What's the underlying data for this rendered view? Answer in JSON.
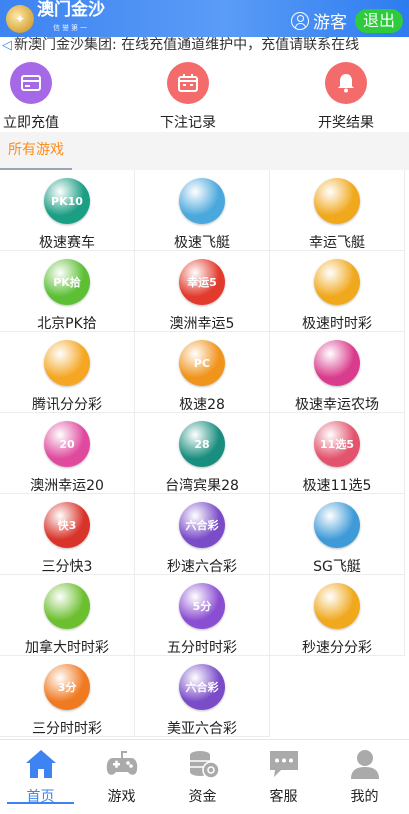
{
  "header": {
    "logo_text": "澳门金沙",
    "logo_sub": "信誉第一",
    "guest_label": "游客",
    "logout_label": "退出",
    "color_bg": "#3d83f2"
  },
  "marquee": {
    "text": "新澳门金沙集团: 在线充值通道维护中，充值请联系在线"
  },
  "quick_actions": [
    {
      "label": "立即充值",
      "icon": "wallet-icon",
      "color": "#a569e8"
    },
    {
      "label": "下注记录",
      "icon": "calendar-icon",
      "color": "#f46b6b"
    },
    {
      "label": "开奖结果",
      "icon": "bell-icon",
      "color": "#f46b6b"
    }
  ],
  "section": {
    "tab_label": "所有游戏",
    "accent": "#ff8c1a"
  },
  "games": [
    {
      "label": "极速赛车",
      "badge": "PK10",
      "color": "#1a9e84"
    },
    {
      "label": "极速飞艇",
      "badge": "",
      "color": "#4aa8dc"
    },
    {
      "label": "幸运飞艇",
      "badge": "",
      "color": "#f0a81c"
    },
    {
      "label": "北京PK拾",
      "badge": "PK拾",
      "color": "#5cbf34"
    },
    {
      "label": "澳洲幸运5",
      "badge": "幸运5",
      "color": "#e23a2c"
    },
    {
      "label": "极速时时彩",
      "badge": "",
      "color": "#f0a81c"
    },
    {
      "label": "腾讯分分彩",
      "badge": "",
      "color": "#f5a623"
    },
    {
      "label": "极速28",
      "badge": "PC",
      "color": "#f0941c"
    },
    {
      "label": "极速幸运农场",
      "badge": "",
      "color": "#d93c8c"
    },
    {
      "label": "澳洲幸运20",
      "badge": "20",
      "color": "#e04a9e"
    },
    {
      "label": "台湾宾果28",
      "badge": "28",
      "color": "#1a8e7e"
    },
    {
      "label": "极速11选5",
      "badge": "11选5",
      "color": "#e2546e"
    },
    {
      "label": "三分快3",
      "badge": "快3",
      "color": "#d8342a"
    },
    {
      "label": "秒速六合彩",
      "badge": "六合彩",
      "color": "#7a4cc8"
    },
    {
      "label": "SG飞艇",
      "badge": "",
      "color": "#3f9ad8"
    },
    {
      "label": "加拿大时时彩",
      "badge": "",
      "color": "#6cbf2e"
    },
    {
      "label": "五分时时彩",
      "badge": "5分",
      "color": "#8a4ed2"
    },
    {
      "label": "秒速分分彩",
      "badge": "",
      "color": "#f0a81c"
    },
    {
      "label": "三分时时彩",
      "badge": "3分",
      "color": "#f07a22"
    },
    {
      "label": "美亚六合彩",
      "badge": "六合彩",
      "color": "#7a4cc8"
    }
  ],
  "nav": [
    {
      "label": "首页",
      "icon": "home-icon",
      "active": true
    },
    {
      "label": "游戏",
      "icon": "gamepad-icon",
      "active": false
    },
    {
      "label": "资金",
      "icon": "coins-icon",
      "active": false
    },
    {
      "label": "客服",
      "icon": "chat-icon",
      "active": false
    },
    {
      "label": "我的",
      "icon": "person-icon",
      "active": false
    }
  ]
}
